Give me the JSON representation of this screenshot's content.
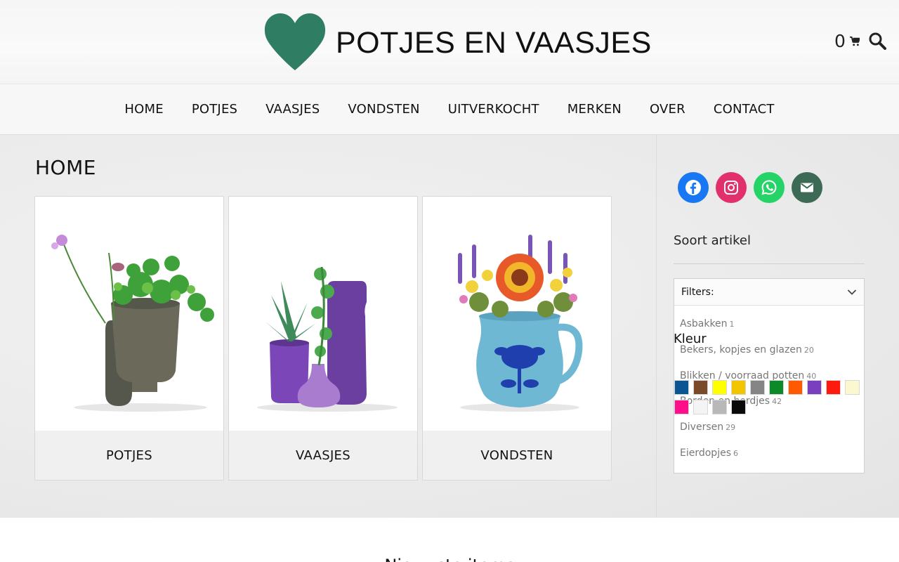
{
  "brand": {
    "name": "POTJES EN VAASJES",
    "heart_color": "#2f7d63"
  },
  "header": {
    "cart_count": "0"
  },
  "nav": {
    "items": [
      {
        "label": "HOME"
      },
      {
        "label": "POTJES"
      },
      {
        "label": "VAASJES"
      },
      {
        "label": "VONDSTEN"
      },
      {
        "label": "UITVERKOCHT"
      },
      {
        "label": "MERKEN"
      },
      {
        "label": "OVER"
      },
      {
        "label": "CONTACT"
      }
    ]
  },
  "main": {
    "title": "HOME",
    "categories": [
      {
        "label": "POTJES",
        "image": "green ceramic pots with plants"
      },
      {
        "label": "VAASJES",
        "image": "purple vases with succulents"
      },
      {
        "label": "VONDSTEN",
        "image": "blue jug with flowers"
      }
    ]
  },
  "sidebar": {
    "social": [
      {
        "name": "facebook",
        "color": "#1877f2"
      },
      {
        "name": "instagram",
        "color": "#e1306c"
      },
      {
        "name": "whatsapp",
        "color": "#25d366"
      },
      {
        "name": "email",
        "color": "#3d6a54"
      }
    ],
    "soort_title": "Soort artikel",
    "filter": {
      "header": "Filters:",
      "options": [
        {
          "label": "Asbakken",
          "count": "1"
        },
        {
          "label": "Bekers, kopjes en glazen",
          "count": "20"
        },
        {
          "label": "Blikken / voorraad potten",
          "count": "40"
        },
        {
          "label": "Borden en bordjes",
          "count": "42"
        },
        {
          "label": "Diversen",
          "count": "29"
        },
        {
          "label": "Eierdopjes",
          "count": "6"
        }
      ]
    },
    "kleur_title": "Kleur",
    "colors": [
      "#0b5594",
      "#7a4a2a",
      "#ffff00",
      "#f2c500",
      "#858585",
      "#0c8a2a",
      "#ff5a00",
      "#7a3fbf",
      "#ff1a0f",
      "#fbf7cf",
      "#ff0f8a",
      "#f4f4f4",
      "#b8b8b8",
      "#0a0a0a"
    ]
  },
  "footer": {
    "heading": "Nieuwste items"
  }
}
